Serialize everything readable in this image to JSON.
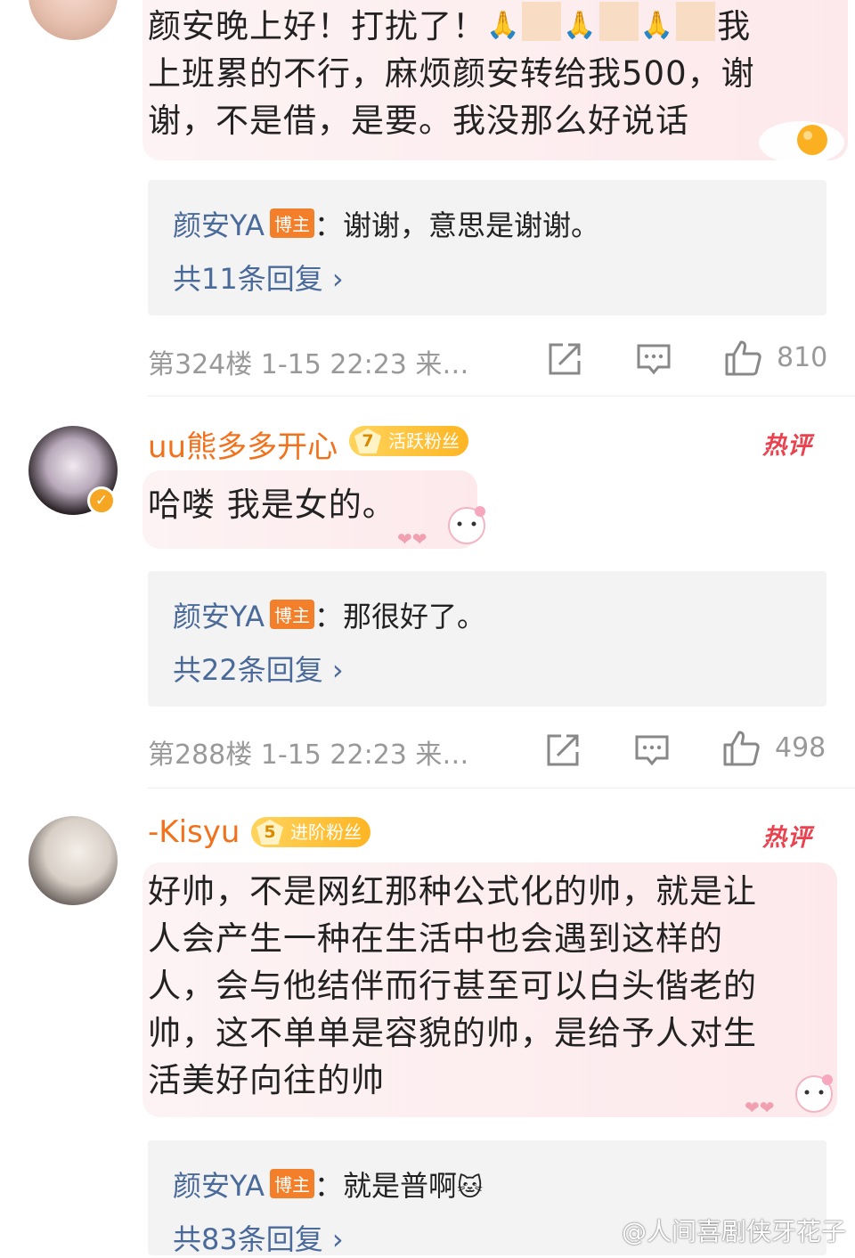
{
  "comments": [
    {
      "text_line1_pre": "颜安晚上好！打扰了！",
      "text_line1_post": "我",
      "text_line2": "上班累的不行，麻烦颜安转给我500，谢",
      "text_line3": "谢，不是借，是要。我没那么好说话",
      "reply": {
        "user": "颜安YA",
        "badge": "博主",
        "text": "：谢谢，意思是谢谢。",
        "more": "共11条回复 ›"
      },
      "meta": "第324楼 1-15 22:23 来…",
      "likes": "810"
    },
    {
      "username": "uu熊多多开心",
      "fan_level": "7",
      "fan_label": "活跃粉丝",
      "hot": "热评",
      "text": "哈喽 我是女的。",
      "reply": {
        "user": "颜安YA",
        "badge": "博主",
        "text": "：那很好了。",
        "more": "共22条回复 ›"
      },
      "meta": "第288楼 1-15 22:23 来…",
      "likes": "498"
    },
    {
      "username": "-Kisyu",
      "fan_level": "5",
      "fan_label": "进阶粉丝",
      "hot": "热评",
      "lines": [
        "好帅，不是网红那种公式化的帅，就是让",
        "人会产生一种在生活中也会遇到这样的",
        "人，会与他结伴而行甚至可以白头偕老的",
        "帅，这不单单是容貌的帅，是给予人对生",
        "活美好向往的帅"
      ],
      "reply": {
        "user": "颜安YA",
        "badge": "博主",
        "text": "：就是普啊",
        "more": "共83条回复 ›"
      }
    }
  ],
  "watermark": "@人间喜剧侠牙花子",
  "colors": {
    "username": "#f2711c",
    "reply_user": "#4a6a9a",
    "badge": "#f47f2a",
    "hot": "#e8434f"
  }
}
